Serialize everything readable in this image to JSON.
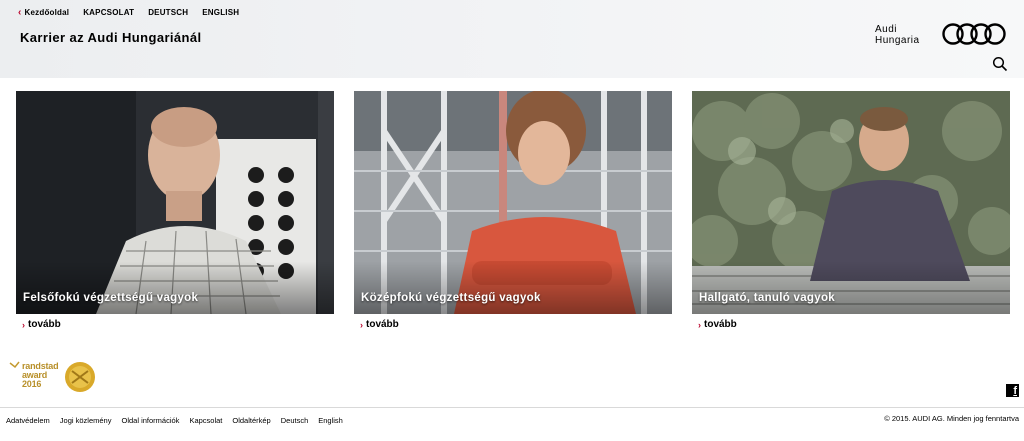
{
  "header": {
    "nav": [
      {
        "label": "Kezdőoldal"
      },
      {
        "label": "KAPCSOLAT"
      },
      {
        "label": "DEUTSCH"
      },
      {
        "label": "ENGLISH"
      }
    ],
    "title": "Karrier az Audi Hungariánál",
    "brand_line1": "Audi",
    "brand_line2": "Hungaria",
    "brand_icon": "audi-rings-icon",
    "search_icon": "search-icon"
  },
  "tiles": [
    {
      "caption": "Felsőfokú végzettségű vagyok",
      "more": "tovább"
    },
    {
      "caption": "Középfokú végzettségű vagyok",
      "more": "tovább"
    },
    {
      "caption": "Hallgató, tanuló vagyok",
      "more": "tovább"
    }
  ],
  "award": {
    "line1": "randstad",
    "line2": "award",
    "line3": "2016"
  },
  "social": {
    "facebook_glyph": "f",
    "icon": "facebook-icon"
  },
  "footer": {
    "links": [
      "Adatvédelem",
      "Jogi közlemény",
      "Oldal információk",
      "Kapcsolat",
      "Oldaltérkép",
      "Deutsch",
      "English"
    ],
    "copyright": "© 2015. AUDI AG. Minden jog fenntartva"
  },
  "colors": {
    "accent": "#bb0a30",
    "header_bg": "#eceef0"
  }
}
